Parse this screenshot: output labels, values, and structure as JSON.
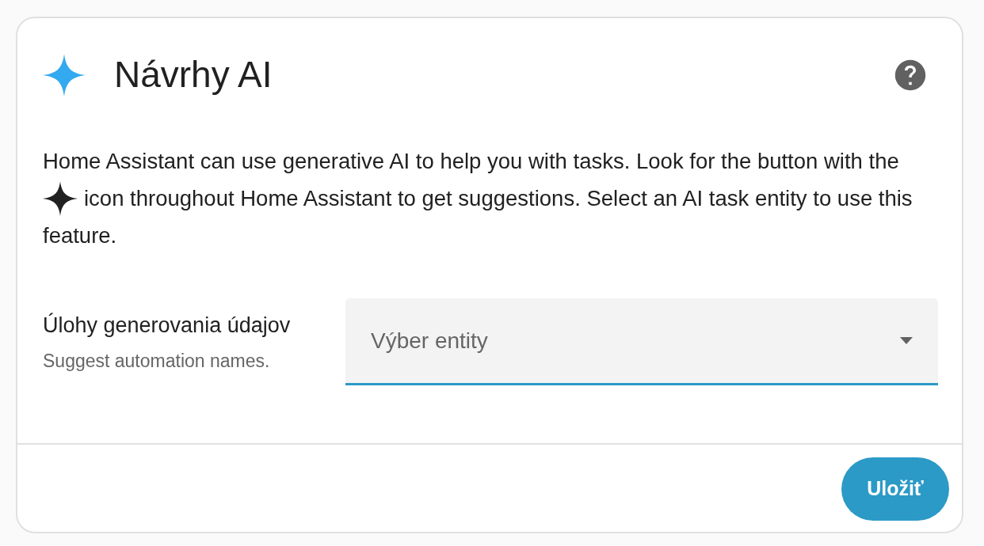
{
  "dialog": {
    "title": "Návrhy AI",
    "description_before": "Home Assistant can use generative AI to help you with tasks. Look for the button with the",
    "description_after": "icon throughout Home Assistant to get suggestions. Select an AI task entity to use this",
    "description_end": "feature."
  },
  "setting": {
    "label": "Úlohy generovania údajov",
    "hint": "Suggest automation names.",
    "select": {
      "placeholder": "Výber entity",
      "focused": true
    }
  },
  "buttons": [
    {
      "label": "Uložiť"
    }
  ]
}
